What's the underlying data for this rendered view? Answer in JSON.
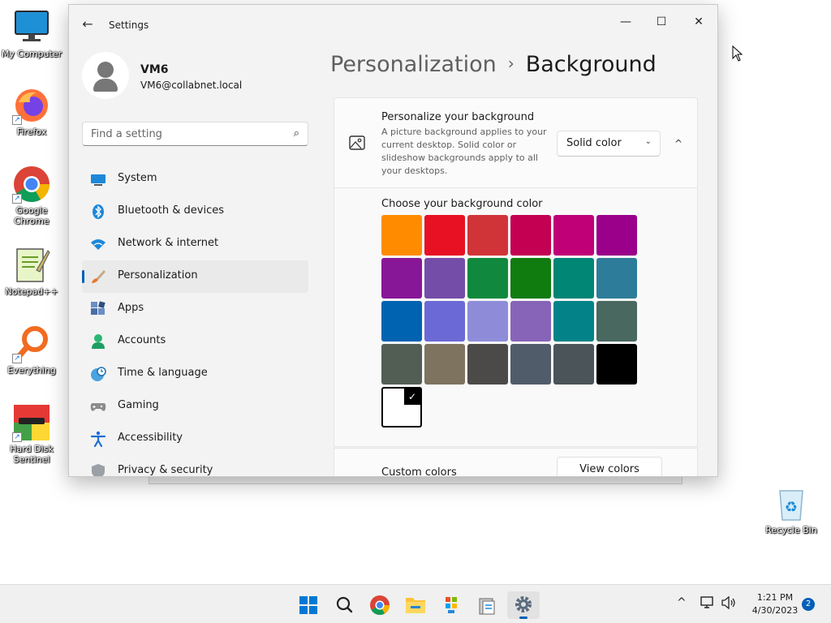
{
  "desktop": {
    "icons": [
      {
        "label": "My Computer"
      },
      {
        "label": "Firefox"
      },
      {
        "label": "Google Chrome"
      },
      {
        "label": "Notepad++"
      },
      {
        "label": "Everything"
      },
      {
        "label": "Hard Disk Sentinel"
      },
      {
        "label": "Recycle Bin"
      }
    ]
  },
  "window": {
    "title": "Settings",
    "minimize_glyph": "—",
    "maximize_glyph": "☐",
    "close_glyph": "✕",
    "back_glyph": "←"
  },
  "profile": {
    "name": "VM6",
    "email": "VM6@collabnet.local"
  },
  "search": {
    "placeholder": "Find a setting",
    "icon_glyph": "⌕"
  },
  "nav": {
    "items": [
      {
        "label": "System",
        "icon": "system-icon"
      },
      {
        "label": "Bluetooth & devices",
        "icon": "bluetooth-icon"
      },
      {
        "label": "Network & internet",
        "icon": "wifi-icon"
      },
      {
        "label": "Personalization",
        "icon": "brush-icon",
        "active": true
      },
      {
        "label": "Apps",
        "icon": "apps-icon"
      },
      {
        "label": "Accounts",
        "icon": "person-icon"
      },
      {
        "label": "Time & language",
        "icon": "clock-globe-icon"
      },
      {
        "label": "Gaming",
        "icon": "gamepad-icon"
      },
      {
        "label": "Accessibility",
        "icon": "accessibility-icon"
      },
      {
        "label": "Privacy & security",
        "icon": "shield-icon"
      }
    ]
  },
  "breadcrumb": {
    "parent": "Personalization",
    "separator": "›",
    "current": "Background"
  },
  "background_card": {
    "title": "Personalize your background",
    "description": "A picture background applies to your current desktop. Solid color or slideshow backgrounds apply to all your desktops.",
    "dropdown_value": "Solid color",
    "dropdown_chevron": "⌄",
    "collapse_glyph": "^"
  },
  "color_section": {
    "title": "Choose your background color",
    "colors": [
      "#ff8c00",
      "#e81123",
      "#d13438",
      "#c30052",
      "#bf0077",
      "#9a0089",
      "#881798",
      "#744da9",
      "#10893e",
      "#107c10",
      "#018574",
      "#2d7d9a",
      "#0063b1",
      "#6b69d6",
      "#8e8cd8",
      "#8764b8",
      "#038387",
      "#486860",
      "#525e54",
      "#7e735f",
      "#4c4a48",
      "#515c6b",
      "#4a5459",
      "#000000"
    ],
    "selected_color": "#ffffff",
    "check_glyph": "✓"
  },
  "custom_colors": {
    "label": "Custom colors",
    "button": "View colors"
  },
  "taskbar": {
    "time": "1:21 PM",
    "date": "4/30/2023",
    "notifications": "2",
    "tray_chevron": "^",
    "accent": "#005fb8"
  }
}
